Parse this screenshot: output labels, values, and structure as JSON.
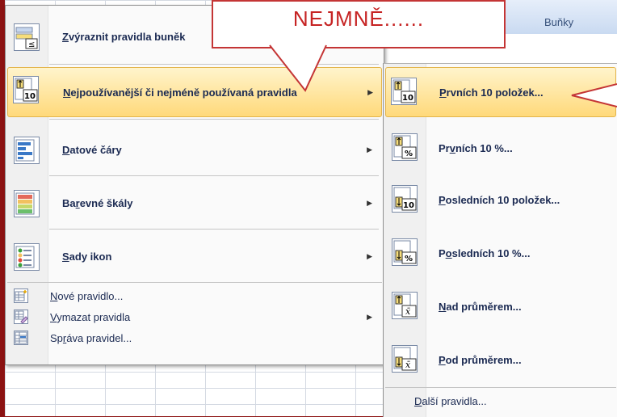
{
  "ribbon": {
    "group_label": "Buňky"
  },
  "callout": {
    "text": "NEJMNĚ......"
  },
  "menu": {
    "items": [
      {
        "name": "highlight-rules",
        "prefix": "",
        "underline": "Z",
        "rest": "výraznit pravidla buněk",
        "icon": "highlight-cells-icon"
      },
      {
        "name": "top-bottom-rules",
        "prefix": "",
        "underline": "N",
        "rest": "ejpoužívanější či nejméně používaná pravidla",
        "icon": "top-bottom-icon"
      },
      {
        "name": "data-bars",
        "prefix": "",
        "underline": "D",
        "rest": "atové čáry",
        "icon": "data-bars-icon"
      },
      {
        "name": "color-scales",
        "prefix": "Ba",
        "underline": "r",
        "rest": "evné škály",
        "icon": "color-scales-icon"
      },
      {
        "name": "icon-sets",
        "prefix": "",
        "underline": "S",
        "rest": "ady ikon",
        "icon": "icon-sets-icon"
      }
    ],
    "small_items": [
      {
        "name": "new-rule",
        "prefix": "",
        "underline": "N",
        "rest": "ové pravidlo...",
        "icon": "new-rule-icon"
      },
      {
        "name": "clear-rules",
        "prefix": "",
        "underline": "V",
        "rest": "ymazat pravidla",
        "icon": "clear-rules-icon"
      },
      {
        "name": "manage-rules",
        "prefix": "Sp",
        "underline": "r",
        "rest": "áva pravidel...",
        "icon": "manage-rules-icon"
      }
    ]
  },
  "submenu": {
    "items": [
      {
        "prefix": "",
        "underline": "P",
        "rest": "rvních 10 položek...",
        "icon": "top-10-items-icon",
        "badge": "10"
      },
      {
        "prefix": "Pr",
        "underline": "v",
        "rest": "ních 10 %...",
        "icon": "top-10-percent-icon",
        "badge": "%"
      },
      {
        "prefix": "",
        "underline": "P",
        "rest": "osledních 10 položek...",
        "icon": "bottom-10-items-icon",
        "badge": "10"
      },
      {
        "prefix": "P",
        "underline": "o",
        "rest": "sledních 10 %...",
        "icon": "bottom-10-percent-icon",
        "badge": "%"
      },
      {
        "prefix": "",
        "underline": "N",
        "rest": "ad průměrem...",
        "icon": "above-average-icon",
        "badge": "x̄"
      },
      {
        "prefix": "",
        "underline": "P",
        "rest": "od průměrem...",
        "icon": "below-average-icon",
        "badge": "x̄"
      }
    ],
    "more": {
      "prefix": "",
      "underline": "D",
      "rest": "alší pravidla..."
    }
  },
  "colors": {
    "accent_highlight": "#ffd97a",
    "callout_red": "#c62323",
    "background_red": "#8c1212"
  }
}
